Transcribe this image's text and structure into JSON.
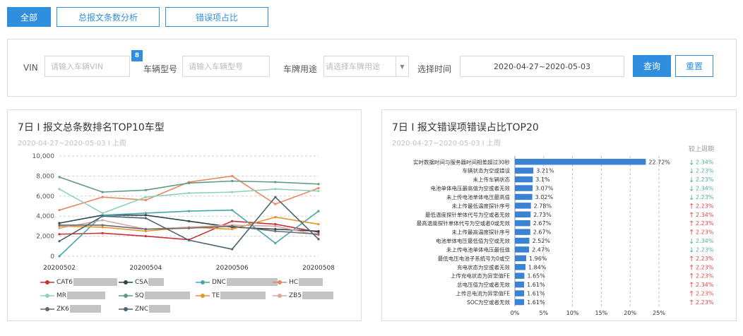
{
  "tabs": [
    {
      "label": "全部",
      "active": true
    },
    {
      "label": "总报文条数分析",
      "active": false
    },
    {
      "label": "错误项占比",
      "active": false
    }
  ],
  "filter": {
    "vin_label": "VIN",
    "vin_placeholder": "请输入车辆VIN",
    "vin_badge": "8",
    "model_label": "车辆型号",
    "model_placeholder": "请输入车辆型号",
    "usage_label": "车牌用途",
    "usage_placeholder": "请选择车牌用途",
    "time_label": "选择时间",
    "time_value": "2020-04-27~2020-05-03",
    "query_label": "查询",
    "reset_label": "重置"
  },
  "left_panel": {
    "title": "7日 I 报文总条数排名TOP10车型",
    "subtitle": "2020-04-27~2020-05-03 I 上周"
  },
  "right_panel": {
    "title": "7日 I 报文错误项错误占比TOP20",
    "subtitle": "2020-04-27~2020-05-03 I 上周",
    "compare_header": "较上周期"
  },
  "colors": {
    "accent": "#2f8fde",
    "up": "#e2474b",
    "down": "#4db29b",
    "bar": "#3a83d4"
  },
  "chart_data": [
    {
      "type": "line",
      "x": [
        "20200502",
        "20200503",
        "20200504",
        "20200505",
        "20200506",
        "20200507",
        "20200508"
      ],
      "x_tick_labels": [
        "20200502",
        "20200504",
        "20200506",
        "20200508"
      ],
      "ylim": [
        0,
        10000
      ],
      "y_ticks": [
        "10,000",
        "8,000",
        "6,000",
        "4,000",
        "2,000",
        "0"
      ],
      "grid": true,
      "legend_placement": "bottom",
      "series": [
        {
          "name": "CAT6",
          "color": "#c8303a",
          "values": [
            2200,
            2300,
            2000,
            1650,
            3500,
            3200,
            2400
          ]
        },
        {
          "name": "CSA",
          "color": "#2c4350",
          "values": [
            3300,
            4100,
            4100,
            3500,
            2900,
            2700,
            2500
          ]
        },
        {
          "name": "DNC",
          "color": "#45a8b0",
          "values": [
            0,
            4100,
            4300,
            4500,
            4600,
            1300,
            4500
          ]
        },
        {
          "name": "HC",
          "color": "#e88666",
          "values": [
            4600,
            5900,
            5600,
            7400,
            8000,
            5200,
            6800
          ]
        },
        {
          "name": "MR",
          "color": "#8ed3b8",
          "values": [
            6700,
            4300,
            5900,
            6300,
            6400,
            6700,
            6500
          ]
        },
        {
          "name": "SQ",
          "color": "#5f9c7e",
          "values": [
            7900,
            6400,
            6600,
            7300,
            7500,
            7400,
            7200
          ]
        },
        {
          "name": "TE",
          "color": "#e8932e",
          "values": [
            3000,
            2900,
            2500,
            2900,
            2700,
            3900,
            3200
          ]
        },
        {
          "name": "ZB5",
          "color": "#d4a89e",
          "values": [
            2800,
            3600,
            2700,
            2900,
            3100,
            3000,
            2100
          ]
        },
        {
          "name": "ZK6",
          "color": "#6a6a6a",
          "values": [
            3100,
            3100,
            2700,
            2800,
            3000,
            2500,
            2200
          ]
        },
        {
          "name": "ZNC",
          "color": "#4b6473",
          "values": [
            1500,
            4000,
            3800,
            1600,
            700,
            5900,
            1700
          ]
        }
      ]
    },
    {
      "type": "bar",
      "orientation": "horizontal",
      "categories": [
        "实时数据时间与服务器时间相差超过30秒",
        "车辆状态为空或错误",
        "未上传车辆状态",
        "电池单体电压最高值为空或者无效",
        "未上传电池单体电压最高值",
        "未上传最低温度探针序号",
        "最低温度探针单体代号为空或者无效",
        "最高温度探针单体代号为空或者0或无效",
        "未上传最高温度探针序号",
        "电池单体电压最低值为空或无效",
        "未上传电池单体电压最低值",
        "最低电压电池子系统号为0或空",
        "充电状态为空或者无效",
        "上传充电状态为异常值FE",
        "总电压值为空或者无效",
        "上传总电流为异常值FE",
        "SOC为空或者无效"
      ],
      "values": [
        22.72,
        3.21,
        3.1,
        3.07,
        3.02,
        2.78,
        2.73,
        2.67,
        2.67,
        2.52,
        2.47,
        1.96,
        1.84,
        1.65,
        1.61,
        1.61,
        1.61
      ],
      "value_labels": [
        "22.72%",
        "3.21%",
        "3.1%",
        "3.07%",
        "3.02%",
        "2.78%",
        "2.73%",
        "2.67%",
        "2.67%",
        "2.52%",
        "2.47%",
        "1.96%",
        "1.84%",
        "1.65%",
        "1.61%",
        "1.61%",
        "1.61%"
      ],
      "x_ticks": [
        "0%",
        "5%",
        "10%",
        "15%",
        "20%",
        "25%"
      ],
      "xlim": [
        0,
        25
      ],
      "compare": [
        {
          "dir": "down",
          "text": "2.34%"
        },
        {
          "dir": "down",
          "text": "2.23%"
        },
        {
          "dir": "down",
          "text": "2.23%"
        },
        {
          "dir": "down",
          "text": "2.34%"
        },
        {
          "dir": "down",
          "text": "2.23%"
        },
        {
          "dir": "up",
          "text": "2.23%"
        },
        {
          "dir": "up",
          "text": "2.34%"
        },
        {
          "dir": "up",
          "text": "2.23%"
        },
        {
          "dir": "up",
          "text": "2.23%"
        },
        {
          "dir": "down",
          "text": "2.34%"
        },
        {
          "dir": "down",
          "text": "2.23%"
        },
        {
          "dir": "up",
          "text": "2.23%"
        },
        {
          "dir": "up",
          "text": "2.23%"
        },
        {
          "dir": "up",
          "text": "2.23%"
        },
        {
          "dir": "up",
          "text": "2.34%"
        },
        {
          "dir": "up",
          "text": "2.23%"
        },
        {
          "dir": "up",
          "text": "2.23%"
        }
      ]
    }
  ]
}
